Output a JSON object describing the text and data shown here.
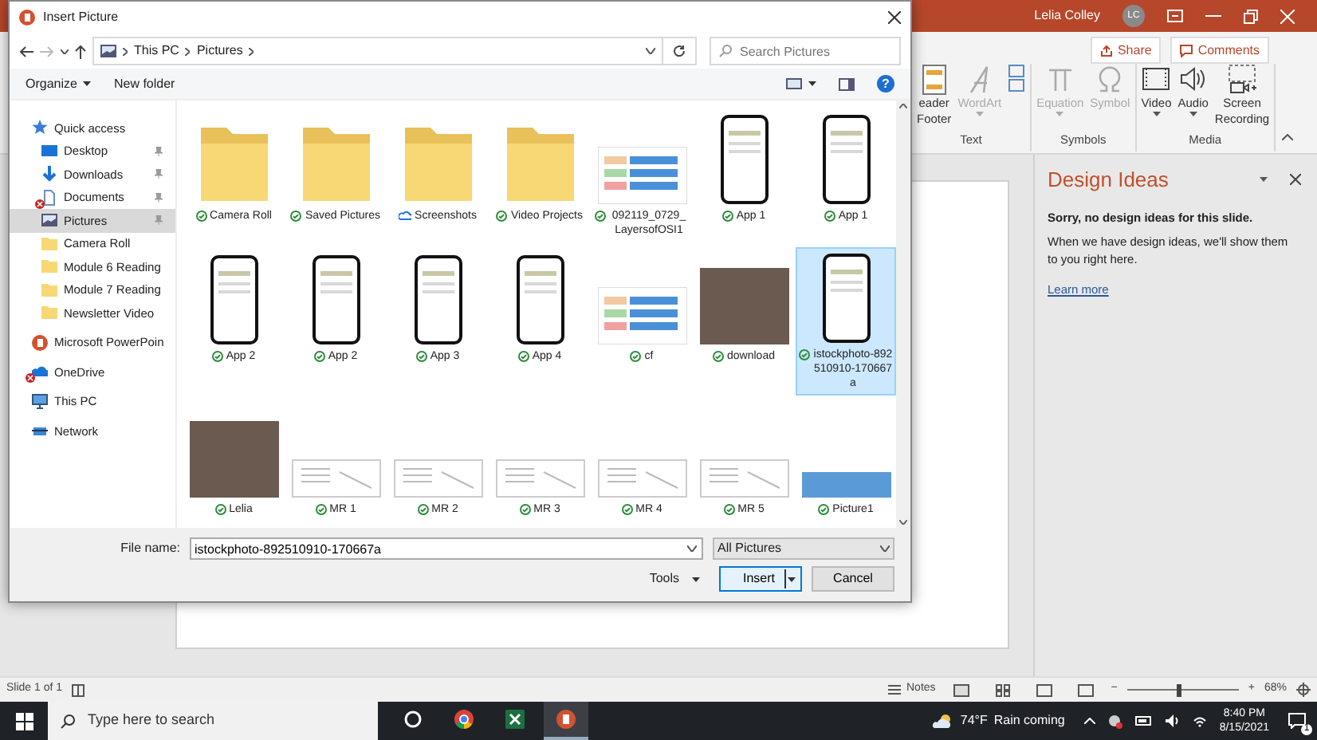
{
  "powerpoint": {
    "title_bar": {
      "user_name": "Lelia Colley",
      "avatar_initials": "LC"
    },
    "ribbon": {
      "share": "Share",
      "comments": "Comments",
      "groups": [
        {
          "label": "Text",
          "commands": [
            {
              "kind": "header",
              "lines": [
                "eader",
                "Footer"
              ],
              "disabled": false
            },
            {
              "kind": "wordart",
              "lines": [
                "WordArt"
              ],
              "disabled": true,
              "dropdown": true
            },
            {
              "kind": "small-icons"
            }
          ]
        },
        {
          "label": "Symbols",
          "commands": [
            {
              "kind": "equation",
              "lines": [
                "Equation"
              ],
              "disabled": true,
              "dropdown": true
            },
            {
              "kind": "symbol",
              "lines": [
                "Symbol"
              ],
              "disabled": true
            }
          ]
        },
        {
          "label": "Media",
          "commands": [
            {
              "kind": "video",
              "lines": [
                "Video"
              ],
              "disabled": false,
              "dropdown": true
            },
            {
              "kind": "audio",
              "lines": [
                "Audio"
              ],
              "disabled": false,
              "dropdown": true
            },
            {
              "kind": "recording",
              "lines": [
                "Screen",
                "Recording"
              ],
              "disabled": false
            }
          ]
        }
      ]
    },
    "design_ideas": {
      "title": "Design Ideas",
      "heading": "Sorry, no design ideas for this slide.",
      "body": "When we have design ideas, we'll show them to you right here.",
      "link": "Learn more"
    },
    "status_bar": {
      "slide": "Slide 1 of 1",
      "notes": "Notes",
      "zoom_out": "−",
      "zoom_in": "+",
      "zoom": {
        "level": 0.47
      },
      "zoom_percent": "68%"
    }
  },
  "dialog": {
    "title": "Insert Picture",
    "address": {
      "path": [
        "This PC",
        "Pictures"
      ],
      "search_placeholder": "Search Pictures"
    },
    "toolbar": {
      "organize": "Organize",
      "new_folder": "New folder",
      "help": "?"
    },
    "sidebar": [
      {
        "label": "Quick access",
        "kind": "star",
        "pinned": false,
        "error": false,
        "selected": false,
        "children": [
          {
            "label": "Desktop",
            "kind": "desktop",
            "pinned": true,
            "error": false,
            "selected": false
          },
          {
            "label": "Downloads",
            "kind": "download",
            "pinned": true,
            "error": false,
            "selected": false
          },
          {
            "label": "Documents",
            "kind": "document",
            "pinned": true,
            "error": true,
            "selected": false
          },
          {
            "label": "Pictures",
            "kind": "pictures",
            "pinned": true,
            "error": false,
            "selected": true
          },
          {
            "label": "Camera Roll",
            "kind": "folder",
            "pinned": false,
            "error": false,
            "selected": false
          },
          {
            "label": "Module 6 Reading",
            "kind": "folder",
            "pinned": false,
            "error": false,
            "selected": false
          },
          {
            "label": "Module 7 Reading",
            "kind": "folder",
            "pinned": false,
            "error": false,
            "selected": false
          },
          {
            "label": "Newsletter Video",
            "kind": "folder",
            "pinned": false,
            "error": false,
            "selected": false
          }
        ]
      },
      {
        "label": "Microsoft PowerPoin",
        "kind": "powerpoint",
        "pinned": false,
        "error": false,
        "selected": false
      },
      {
        "label": "OneDrive",
        "kind": "cloud",
        "pinned": false,
        "error": true,
        "selected": false
      },
      {
        "label": "This PC",
        "kind": "pc",
        "pinned": false,
        "error": false,
        "selected": false
      },
      {
        "label": "Network",
        "kind": "network",
        "pinned": false,
        "error": false,
        "selected": false
      }
    ],
    "files": [
      {
        "name": "Camera Roll",
        "kind": "folder",
        "cloud_only": false,
        "selected": false
      },
      {
        "name": "Saved Pictures",
        "kind": "folder",
        "cloud_only": false,
        "selected": false
      },
      {
        "name": "Screenshots",
        "kind": "folder",
        "cloud_only": true,
        "selected": false
      },
      {
        "name": "Video Projects",
        "kind": "folder",
        "cloud_only": false,
        "selected": false
      },
      {
        "name": "092119_0729_LayersofOSI1",
        "kind": "diagram",
        "cloud_only": false,
        "selected": false
      },
      {
        "name": "App 1",
        "kind": "phone",
        "cloud_only": false,
        "selected": false
      },
      {
        "name": "App 1",
        "kind": "phone",
        "cloud_only": false,
        "selected": false
      },
      {
        "name": "App 2",
        "kind": "phone",
        "cloud_only": false,
        "selected": false
      },
      {
        "name": "App 2",
        "kind": "phone",
        "cloud_only": false,
        "selected": false
      },
      {
        "name": "App 3",
        "kind": "phone",
        "cloud_only": false,
        "selected": false
      },
      {
        "name": "App 4",
        "kind": "phone",
        "cloud_only": false,
        "selected": false
      },
      {
        "name": "cf",
        "kind": "diagram",
        "cloud_only": false,
        "selected": false
      },
      {
        "name": "download",
        "kind": "photo",
        "cloud_only": false,
        "selected": false
      },
      {
        "name": "istockphoto-892510910-170667a",
        "kind": "phone",
        "cloud_only": false,
        "selected": true
      },
      {
        "name": "Lelia",
        "kind": "photo",
        "cloud_only": false,
        "selected": false
      },
      {
        "name": "MR 1",
        "kind": "screenshot",
        "cloud_only": false,
        "selected": false
      },
      {
        "name": "MR 2",
        "kind": "screenshot",
        "cloud_only": false,
        "selected": false
      },
      {
        "name": "MR 3",
        "kind": "screenshot",
        "cloud_only": false,
        "selected": false
      },
      {
        "name": "MR 4",
        "kind": "screenshot",
        "cloud_only": false,
        "selected": false
      },
      {
        "name": "MR 5",
        "kind": "screenshot",
        "cloud_only": false,
        "selected": false
      },
      {
        "name": "Picture1",
        "kind": "banner",
        "cloud_only": false,
        "selected": false
      }
    ],
    "footer": {
      "file_name_label": "File name:",
      "file_name": "istockphoto-892510910-170667a",
      "filter": "All Pictures",
      "tools": "Tools",
      "insert": "Insert",
      "cancel": "Cancel"
    }
  },
  "taskbar": {
    "search_placeholder": "Type here to search",
    "apps": [
      {
        "kind": "cortana",
        "selected": false
      },
      {
        "kind": "chrome",
        "selected": false
      },
      {
        "kind": "excel",
        "selected": false
      },
      {
        "kind": "powerpoint",
        "selected": true
      }
    ],
    "temperature": "74°F",
    "weather": "Rain coming",
    "time": "8:40 PM",
    "date": "8/15/2021",
    "notifications": "1"
  }
}
